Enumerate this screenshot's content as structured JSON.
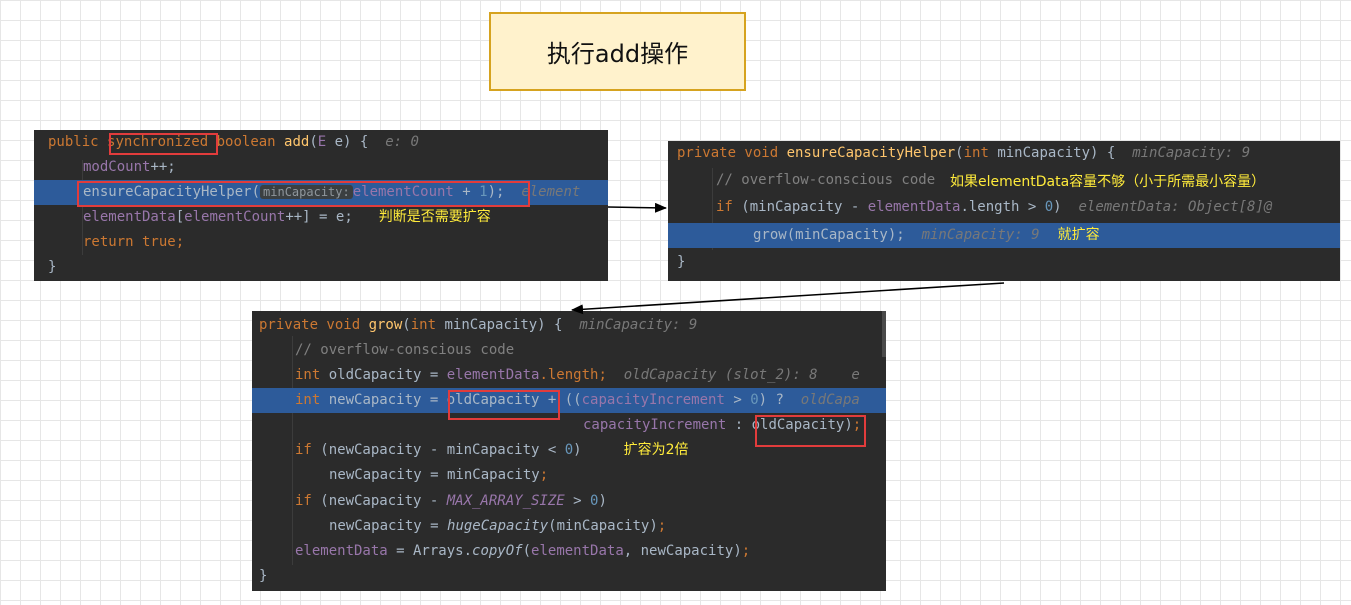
{
  "title": "执行add操作",
  "notes": {
    "check_expand": "判断是否需要扩容",
    "if_not_enough": "如果elementData容量不够（小于所需最小容量）",
    "then_expand": "就扩容",
    "double": "扩容为2倍"
  },
  "panel_add": {
    "l1": {
      "k1": "public ",
      "sync": "synchronized",
      "k2": " boolean ",
      "fn": "add",
      "p1": "(",
      "t": "E",
      "p2": " e) {  ",
      "hint": "e: 0"
    },
    "l2": {
      "fld": "modCount",
      "rest": "++;"
    },
    "l3": {
      "call": "ensureCapacityHelper(",
      "phint": "minCapacity:",
      "fld": "elementCount",
      "rest": " + ",
      "num": "1",
      "end": ");",
      "hint": "  element"
    },
    "l4": {
      "f1": "elementData",
      "b1": "[",
      "f2": "elementCount",
      "rest": "++] = e;"
    },
    "l5": {
      "kw": "return true",
      "rest": ";"
    },
    "l6": "}"
  },
  "panel_helper": {
    "l1": {
      "kw": "private void ",
      "fn": "ensureCapacityHelper",
      "p1": "(",
      "kw2": "int",
      "p2": " minCapacity) {  ",
      "hint": "minCapacity: 9"
    },
    "l2": "// overflow-conscious code",
    "l3": {
      "kw": "if",
      "p1": " (minCapacity - ",
      "fld": "elementData",
      "p2": ".length > ",
      "num": "0",
      "p3": ")  ",
      "hint": "elementData: Object[8]@"
    },
    "l4": {
      "code": "grow(minCapacity);",
      "hint": "  minCapacity: 9"
    },
    "l5": "}"
  },
  "panel_grow": {
    "l1": {
      "kw": "private void ",
      "fn": "grow",
      "p1": "(",
      "kw2": "int",
      "p2": " minCapacity) {  ",
      "hint": "minCapacity: 9"
    },
    "l2": "// overflow-conscious code",
    "l3": {
      "kw": "int",
      "p1": " oldCapacity = ",
      "fld": "elementData",
      "p2": ".length;",
      "hint": "  oldCapacity (slot_2): 8    e"
    },
    "l4": {
      "kw": "int",
      "p1": " newCapacity = ",
      "box": "oldCapacity",
      "p2": " + ((",
      "fld": "capacityIncrement",
      "p3": " > ",
      "num": "0",
      "p4": ") ?  ",
      "hint": "oldCapa"
    },
    "l5": {
      "fld": "capacityIncrement",
      "p1": " : ",
      "box": "oldCapacity",
      "p2": ")",
      "semi": ";"
    },
    "l6": {
      "kw": "if",
      "p1": " (newCapacity - minCapacity < ",
      "num": "0",
      "p2": ")"
    },
    "l7": {
      "code": "newCapacity = minCapacity",
      "semi": ";"
    },
    "l8": {
      "kw": "if",
      "p1": " (newCapacity - ",
      "const": "MAX_ARRAY_SIZE",
      "p2": " > ",
      "num": "0",
      "p3": ")"
    },
    "l9": {
      "p1": "newCapacity = ",
      "fn": "hugeCapacity",
      "p2": "(minCapacity)",
      "semi": ";"
    },
    "l10": {
      "fld": "elementData",
      "p1": " = Arrays.",
      "fn": "copyOf",
      "p2": "(",
      "fld2": "elementData",
      "p3": ", newCapacity)",
      "semi": ";"
    },
    "l11": "}"
  }
}
